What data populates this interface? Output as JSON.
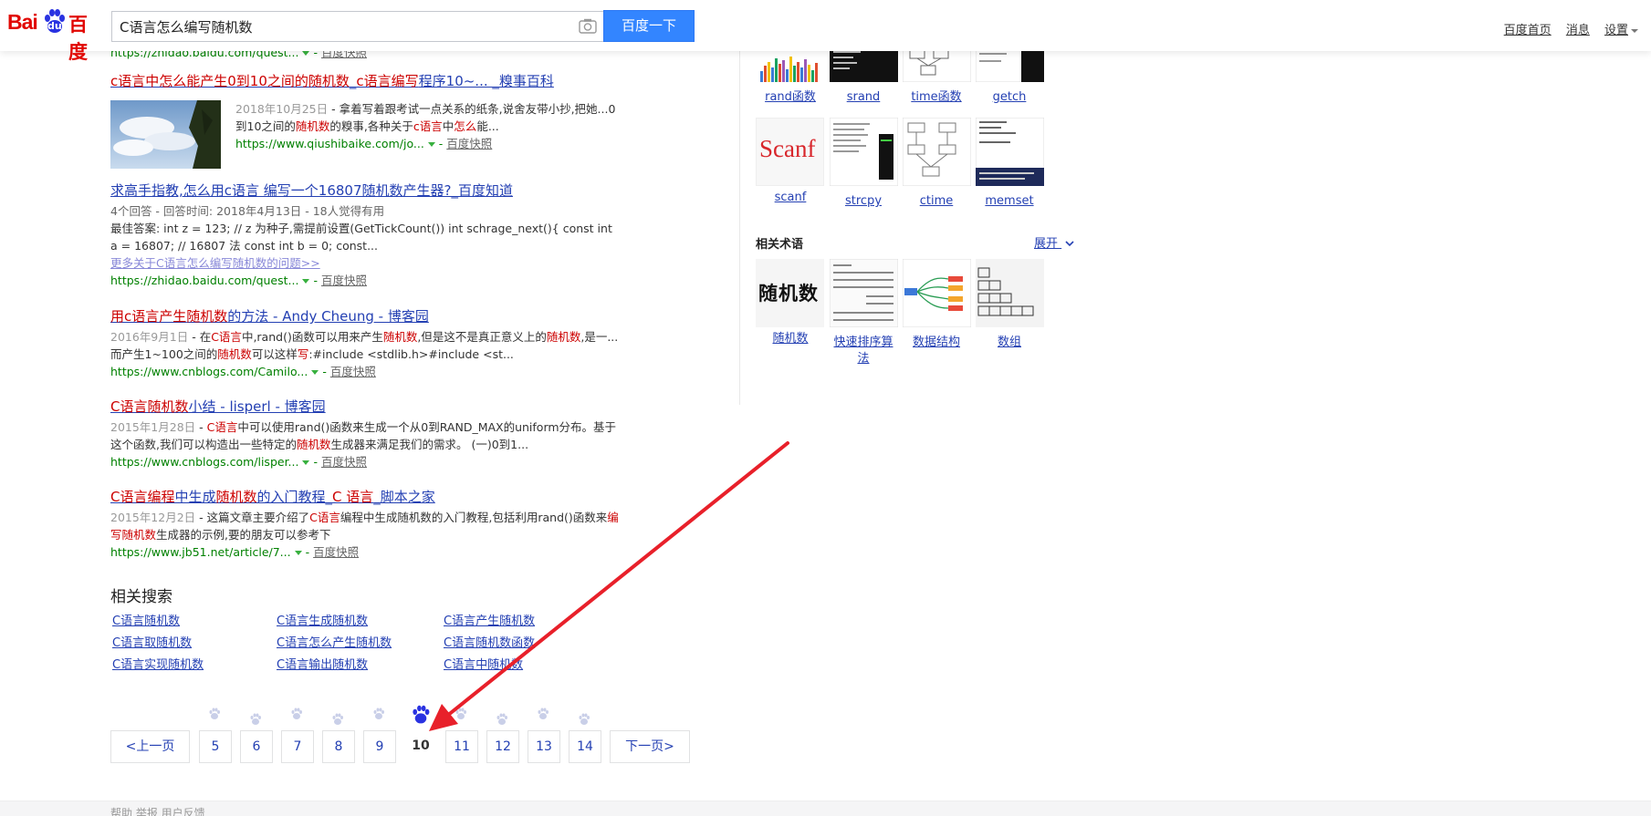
{
  "header": {
    "logo": {
      "bai": "Bai",
      "du": "du",
      "cn": "百度"
    },
    "search_value": "C语言怎么编写随机数",
    "search_button": "百度一下",
    "top_links": [
      "百度首页",
      "消息",
      "设置"
    ]
  },
  "results": [
    {
      "title_parts": [
        "c语言中怎么能产生0到10之间的",
        "随机数",
        "_",
        "c语言编写",
        "程序10~... _糗事百科"
      ],
      "date": "2018年10月25日",
      "abstract_parts": [
        "拿着写着跟考试一点关系的纸条,说舍友带小抄,把她...0到10之间的",
        "随机数",
        "的糗事,各种关于",
        "c语言",
        "中",
        "怎么",
        "能..."
      ],
      "url": "https://www.qiushibaike.com/jo...",
      "cache": "百度快照"
    },
    {
      "title": "求高手指教,怎么用c语言 编写一个16807随机数产生器?_百度知道",
      "meta": "4个回答 - 回答时间: 2018年4月13日 - 18人觉得有用",
      "abstract": "最佳答案: int z = 123; // z 为种子,需提前设置(GetTickCount()) int schrage_next(){ const int a = 16807; // 16807 法 const int b = 0; const...",
      "more": "更多关于C语言怎么编写随机数的问题>>",
      "url": "https://zhidao.baidu.com/quest...",
      "cache": "百度快照"
    },
    {
      "title_parts": [
        "用c语言产生",
        "随机数",
        "的方法 - Andy Cheung - 博客园"
      ],
      "date": "2016年9月1日",
      "abstract_parts": [
        "在",
        "C语言",
        "中,rand()函数可以用来产生",
        "随机数",
        ",但是这不是真正意义上的",
        "随机数",
        ",是一...而产生1~100之间的",
        "随机数",
        "可以这样",
        "写",
        ":#include <stdlib.h>#include <st..."
      ],
      "url": "https://www.cnblogs.com/Camilo...",
      "cache": "百度快照"
    },
    {
      "title_parts": [
        "C语言",
        "随机数",
        "小结 - lisperl - 博客园"
      ],
      "date": "2015年1月28日",
      "abstract_parts": [
        "C语言",
        "中可以使用rand()函数来生成一个从0到RAND_MAX的uniform分布。基于这个函数,我们可以构造出一些特定的",
        "随机数",
        "生成器来满足我们的需求。 (一)0到1..."
      ],
      "url": "https://www.cnblogs.com/lisper...",
      "cache": "百度快照"
    },
    {
      "title_parts": [
        "C语言编程",
        "中生成",
        "随机数",
        "的入门教程_",
        "C 语言",
        "_脚本之家"
      ],
      "date": "2015年12月2日",
      "abstract_parts": [
        "这篇文章主要介绍了",
        "C语言",
        "编程中生成随机数的入门教程,包括利用rand()函数来",
        "编写随机数",
        "生成器的示例,要的朋友可以参考下"
      ],
      "url": "https://www.jb51.net/article/7...",
      "cache": "百度快照"
    }
  ],
  "top_partial": {
    "url": "https://zhidao.baidu.com/quest...",
    "cache": "百度快照"
  },
  "related": {
    "title": "相关搜索",
    "items": [
      "C语言随机数",
      "C语言生成随机数",
      "C语言产生随机数",
      "C语言取随机数",
      "C语言怎么产生随机数",
      "C语言随机数函数",
      "C语言实现随机数",
      "C语言输出随机数",
      "C语言中随机数"
    ]
  },
  "pager": {
    "prev": "<上一页",
    "pages": [
      "5",
      "6",
      "7",
      "8",
      "9",
      "10",
      "11",
      "12",
      "13",
      "14"
    ],
    "current": "10",
    "next": "下一页>"
  },
  "right_col": {
    "row1": [
      "rand函数",
      "srand",
      "time函数",
      "getch"
    ],
    "row2": [
      "scanf",
      "strcpy",
      "ctime",
      "memset"
    ],
    "scanf_img_text": "Scanf",
    "terms_heading": "相关术语",
    "expand": "展开",
    "terms": [
      "随机数",
      "快速排序算法",
      "数据结构",
      "数组"
    ],
    "terms_img_text": "随机数"
  },
  "footer": {
    "links": "帮助 举报 用户反馈"
  },
  "colors": {
    "accent": "#3385ff",
    "brand_red": "#e10601",
    "link": "#2440b3",
    "url_green": "#008000",
    "highlight": "#cc0000",
    "annotation": "#e8202a"
  }
}
